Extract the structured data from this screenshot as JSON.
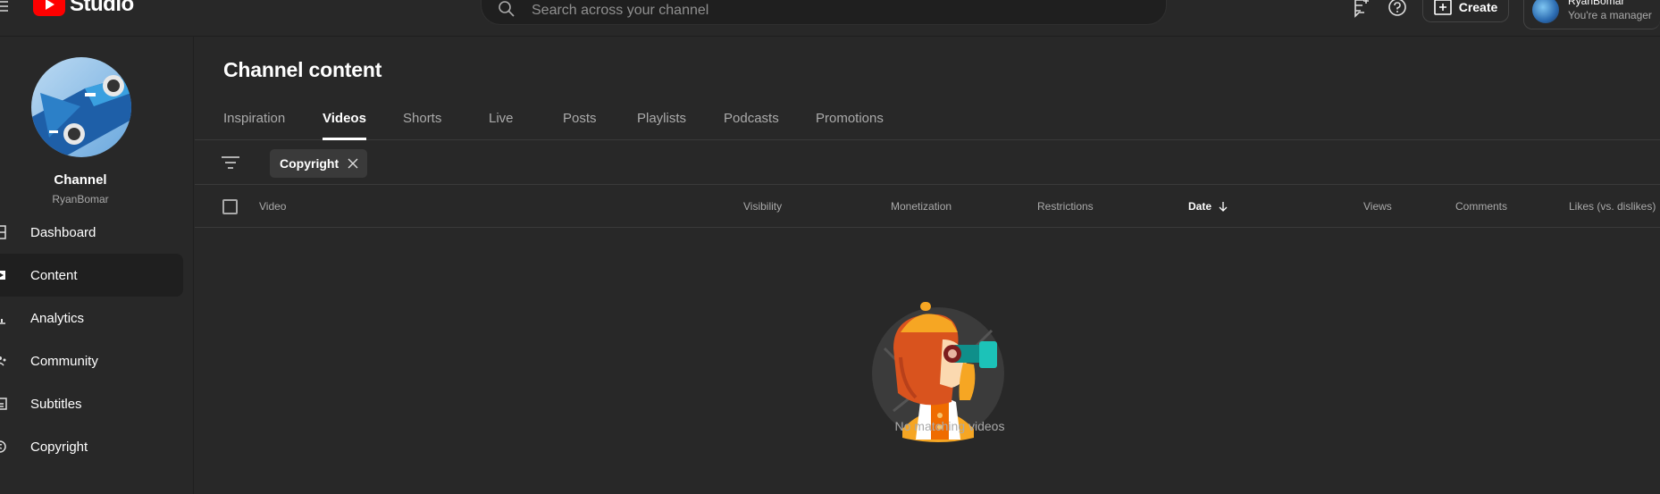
{
  "app": {
    "logo_text": "Studio",
    "brand_color": "#ff0000"
  },
  "search": {
    "placeholder": "Search across your channel"
  },
  "header": {
    "create_label": "Create",
    "account_name": "RyanBomar",
    "account_role": "You're a manager"
  },
  "sidebar": {
    "channel_label": "Channel",
    "channel_handle": "RyanBomar",
    "items": [
      {
        "label": "Dashboard",
        "icon": "dashboard-icon",
        "active": false
      },
      {
        "label": "Content",
        "icon": "content-icon",
        "active": true
      },
      {
        "label": "Analytics",
        "icon": "analytics-icon",
        "active": false
      },
      {
        "label": "Community",
        "icon": "community-icon",
        "active": false
      },
      {
        "label": "Subtitles",
        "icon": "subtitles-icon",
        "active": false
      },
      {
        "label": "Copyright",
        "icon": "copyright-icon",
        "active": false
      }
    ]
  },
  "main": {
    "title": "Channel content",
    "tabs": [
      {
        "label": "Inspiration",
        "active": false
      },
      {
        "label": "Videos",
        "active": true
      },
      {
        "label": "Shorts",
        "active": false
      },
      {
        "label": "Live",
        "active": false
      },
      {
        "label": "Posts",
        "active": false
      },
      {
        "label": "Playlists",
        "active": false
      },
      {
        "label": "Podcasts",
        "active": false
      },
      {
        "label": "Promotions",
        "active": false
      }
    ],
    "filter_chip": "Copyright",
    "columns": [
      {
        "label": "Video"
      },
      {
        "label": "Visibility"
      },
      {
        "label": "Monetization"
      },
      {
        "label": "Restrictions"
      },
      {
        "label": "Date",
        "sorted": "descending"
      },
      {
        "label": "Views"
      },
      {
        "label": "Comments"
      },
      {
        "label": "Likes (vs. dislikes)"
      }
    ],
    "empty_message": "No matching videos"
  }
}
